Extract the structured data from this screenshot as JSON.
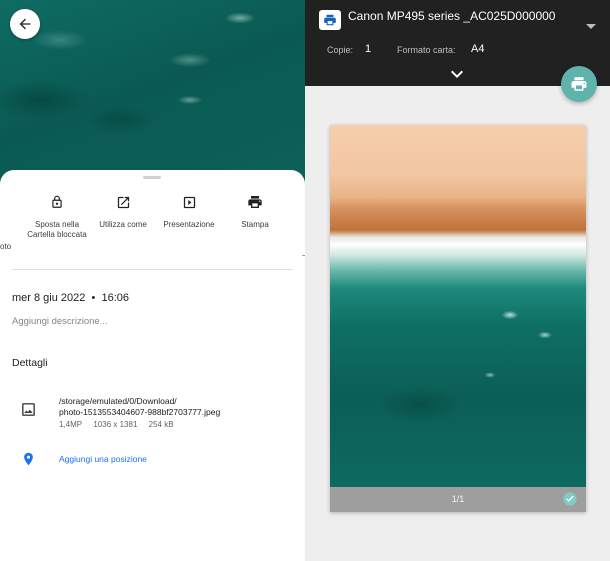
{
  "photo_info": {
    "actions": [
      {
        "label": "Sposta nella Cartella bloccata",
        "icon": "lock-icon"
      },
      {
        "label": "Utilizza come",
        "icon": "open-external-icon"
      },
      {
        "label": "Presentazione",
        "icon": "slideshow-icon"
      },
      {
        "label": "Stampa",
        "icon": "printer-icon"
      }
    ],
    "partial_action_label": "oto",
    "date": "mer 8 giu 2022",
    "time": "16:06",
    "description_placeholder": "Aggiungi descrizione...",
    "details_heading": "Dettagli",
    "file": {
      "path_line1": "/storage/emulated/0/Download/",
      "path_line2": "photo-1513553404607-988bf2703777.jpeg",
      "megapixels": "1,4MP",
      "resolution": "1036 x 1381",
      "size": "254 kB"
    },
    "add_location_label": "Aggiungi una posizione"
  },
  "print": {
    "printer_name": "Canon MP495 series _AC025D000000",
    "copies_label": "Copie:",
    "copies_value": "1",
    "paper_label": "Formato carta:",
    "paper_value": "A4",
    "page_indicator": "1/1"
  },
  "colors": {
    "accent_blue": "#1a73e8",
    "fab_teal": "#5fb3ac",
    "topbar_dark": "#212121"
  }
}
